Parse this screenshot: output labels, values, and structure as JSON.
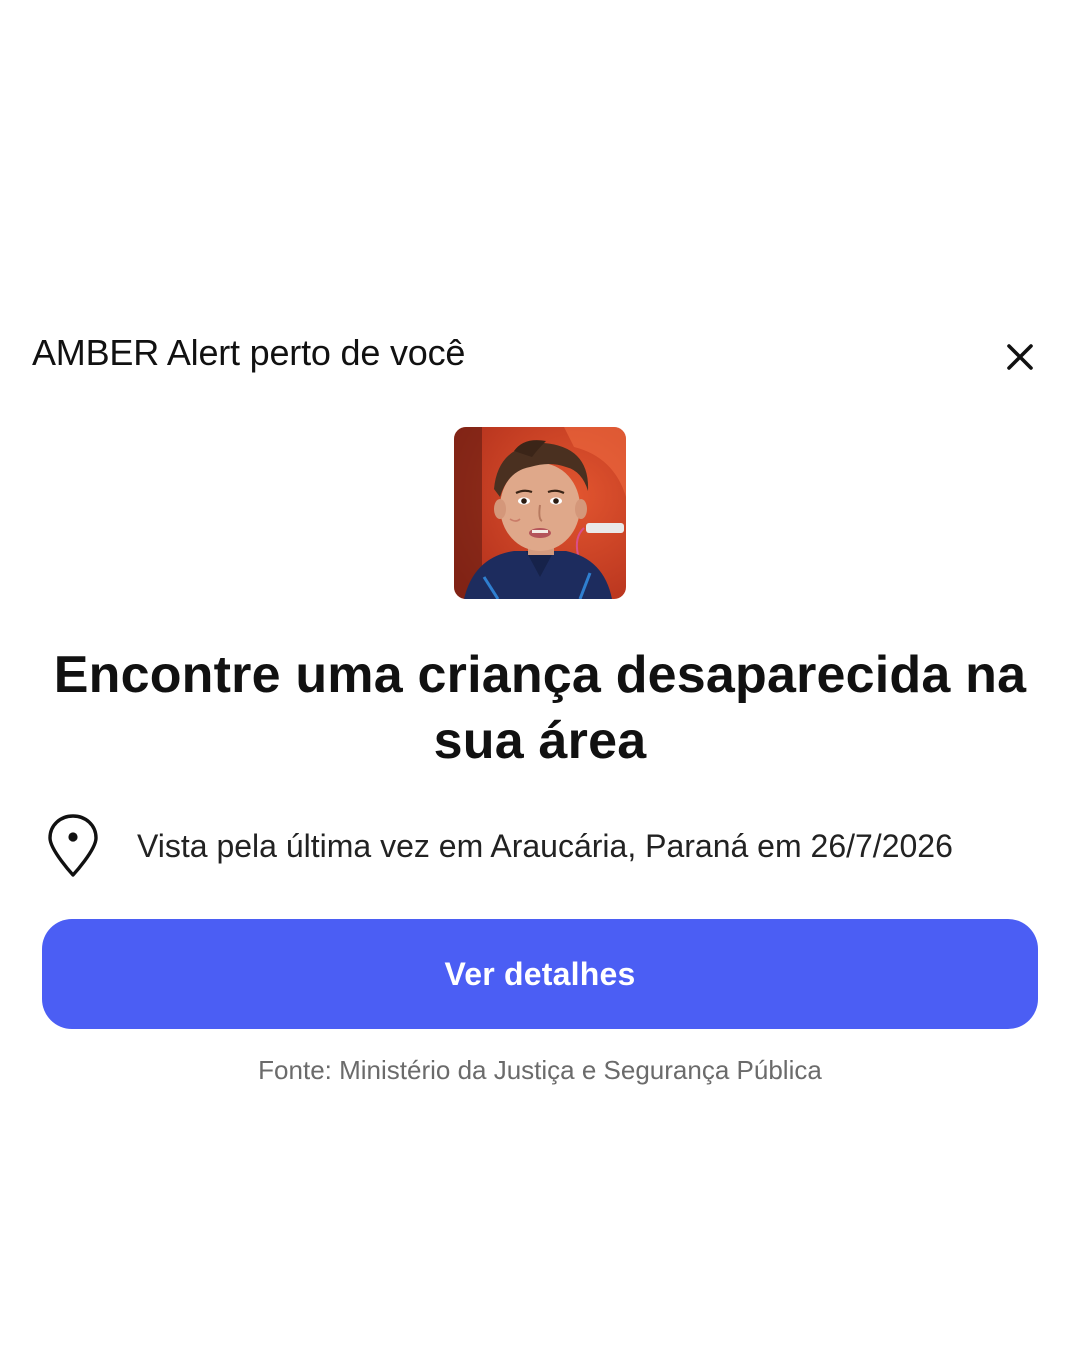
{
  "alert": {
    "header_title": "AMBER Alert perto de você",
    "close_icon": "close-icon",
    "photo_icon": "child-photo",
    "headline": "Encontre uma criança desaparecida na sua área",
    "location_icon": "location-pin-icon",
    "location_text": "Vista pela última vez em Araucária, Paraná em 26/7/2026",
    "button_label": "Ver detalhes",
    "source_text": "Fonte: Ministério da Justiça e Segurança Pública"
  },
  "colors": {
    "accent": "#4b5ef4",
    "background": "#ffffff",
    "text_primary": "#111111",
    "text_secondary": "#6b6b6b"
  }
}
